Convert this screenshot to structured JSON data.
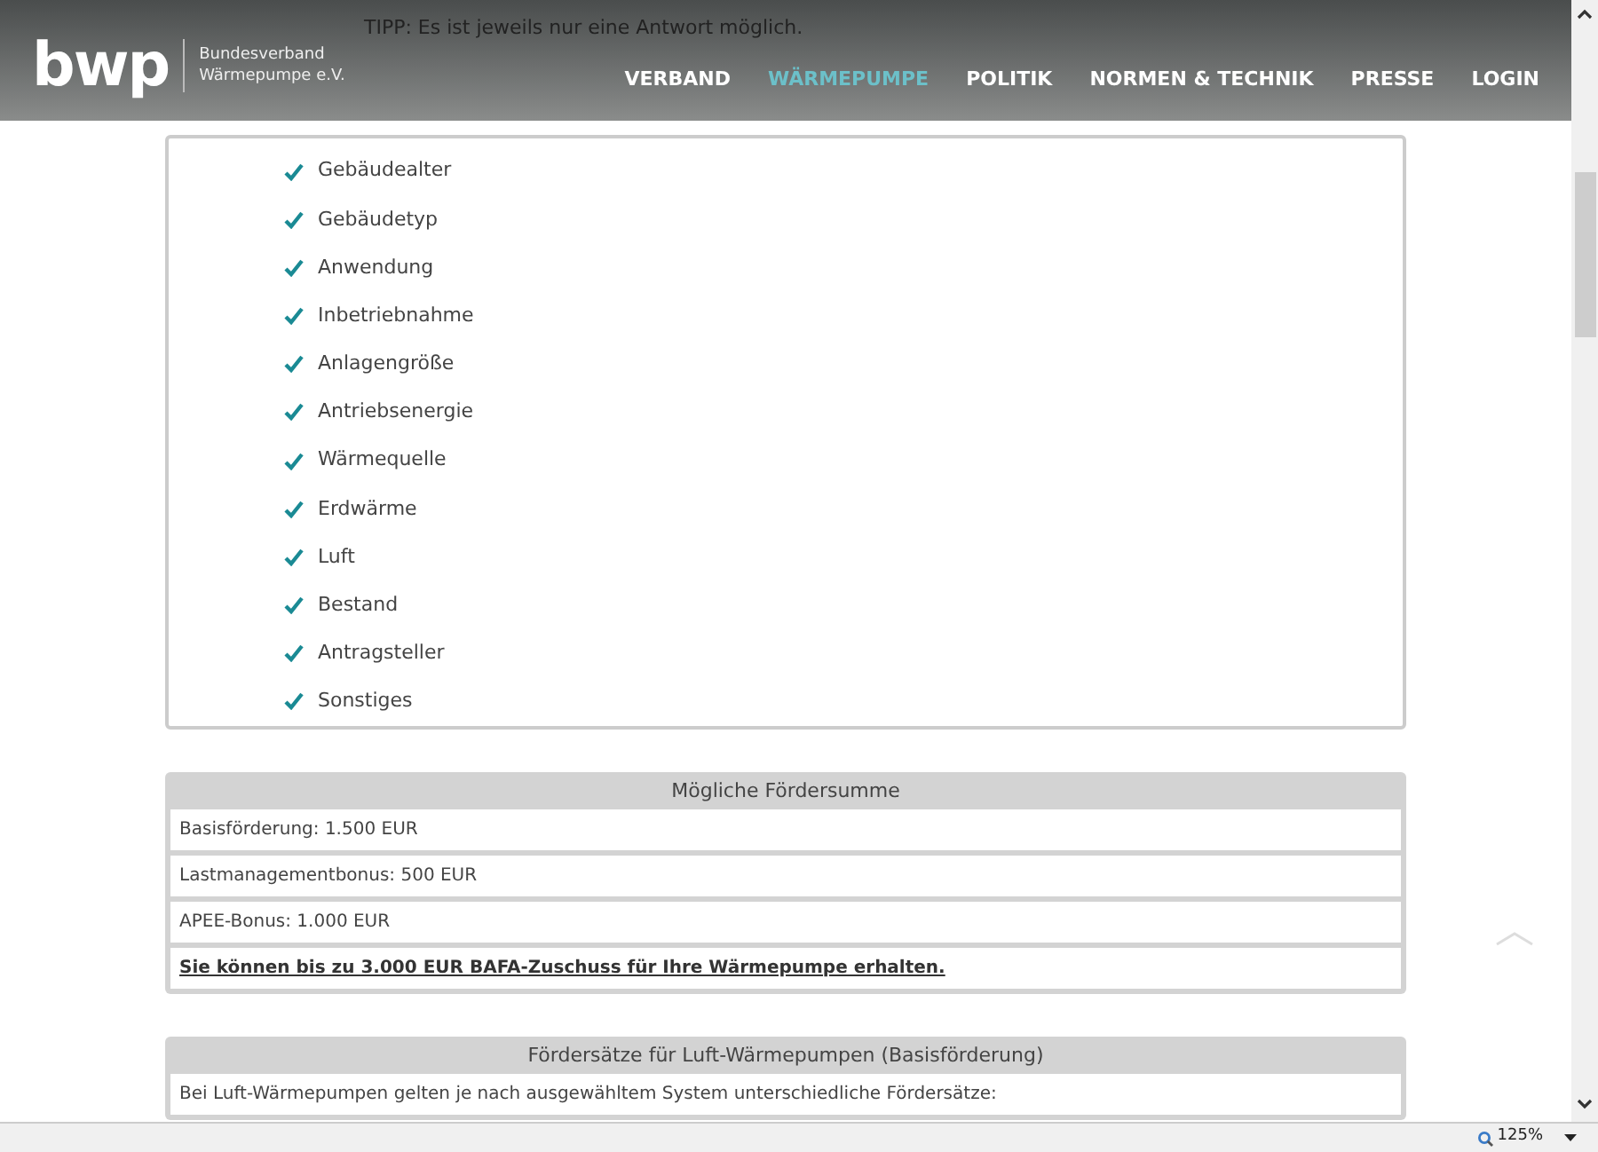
{
  "header": {
    "logo": "bwp",
    "org_line_1": "Bundesverband",
    "org_line_2": "Wärmepumpe e.V.",
    "tip": "TIPP: Es ist jeweils nur eine Antwort möglich.",
    "nav": [
      {
        "label": "VERBAND",
        "selected": false
      },
      {
        "label": "WÄRMEPUMPE",
        "selected": true
      },
      {
        "label": "POLITIK",
        "selected": false
      },
      {
        "label": "NORMEN & TECHNIK",
        "selected": false
      },
      {
        "label": "PRESSE",
        "selected": false
      },
      {
        "label": "LOGIN",
        "selected": false
      }
    ]
  },
  "checklist": [
    {
      "label": "Gebäudealter",
      "checked": true
    },
    {
      "label": "Gebäudetyp",
      "checked": true
    },
    {
      "label": "Anwendung",
      "checked": true
    },
    {
      "label": "Inbetriebnahme",
      "checked": true
    },
    {
      "label": "Anlagengröße",
      "checked": true
    },
    {
      "label": "Antriebsenergie",
      "checked": true
    },
    {
      "label": "Wärmequelle",
      "checked": true
    },
    {
      "label": "Erdwärme",
      "checked": true
    },
    {
      "label": "Luft",
      "checked": true
    },
    {
      "label": "Bestand",
      "checked": true
    },
    {
      "label": "Antragsteller",
      "checked": true
    },
    {
      "label": "Sonstiges",
      "checked": true
    }
  ],
  "panels": [
    {
      "title": "Mögliche Fördersumme",
      "rows": [
        {
          "kind": "text",
          "text": "Basisförderung: 1.500 EUR"
        },
        {
          "kind": "text",
          "text": "Lastmanagementbonus: 500 EUR"
        },
        {
          "kind": "text",
          "text": "APEE-Bonus: 1.000 EUR"
        },
        {
          "kind": "link",
          "text": "Sie können bis zu 3.000 EUR BAFA-Zuschuss für Ihre Wärmepumpe erhalten."
        }
      ]
    },
    {
      "title": "Fördersätze für Luft-Wärmepumpen (Basisförderung)",
      "rows": [
        {
          "kind": "text",
          "text": "Bei Luft-Wärmepumpen gelten je nach ausgewähltem System unterschiedliche Fördersätze:"
        }
      ]
    }
  ],
  "status_bar": {
    "zoom": "125%"
  }
}
